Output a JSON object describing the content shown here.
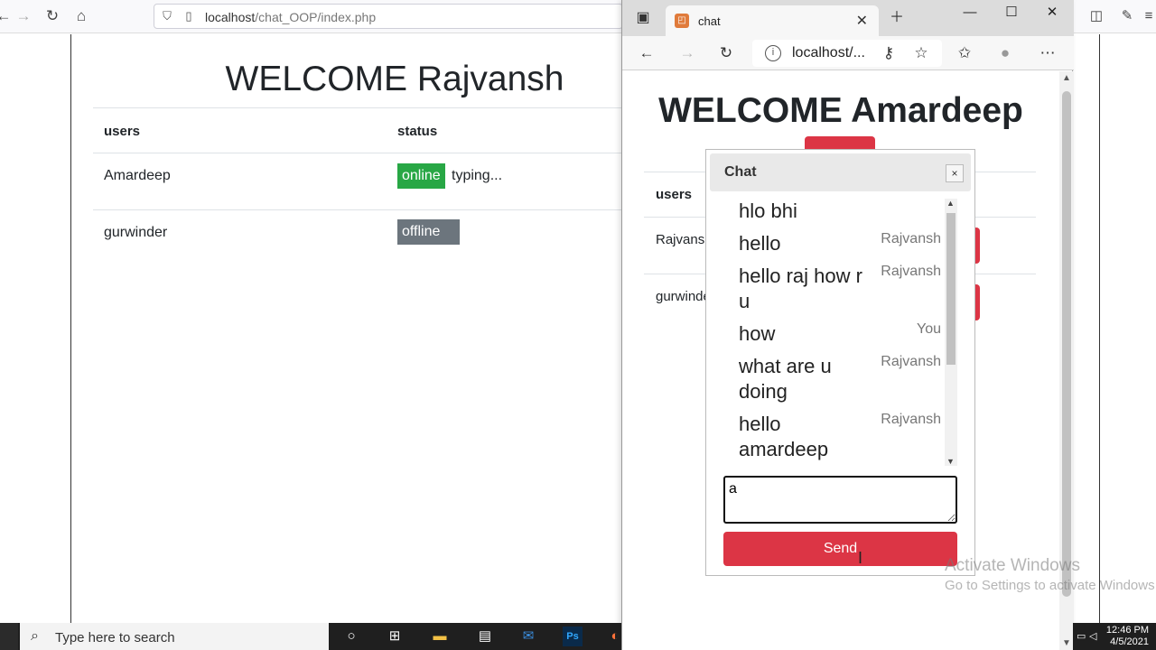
{
  "back_browser": {
    "url_host": "localhost",
    "url_path": "/chat_OOP/index.php",
    "page": {
      "title": "WELCOME Rajvansh",
      "table": {
        "headers": [
          "users",
          "status"
        ],
        "rows": [
          {
            "user": "Amardeep",
            "status": "online",
            "extra": "typing..."
          },
          {
            "user": "gurwinder",
            "status": "offline",
            "extra": ""
          }
        ]
      }
    }
  },
  "front_browser": {
    "tab_title": "chat",
    "address": "localhost/...",
    "page": {
      "title": "WELCOME Amardeep",
      "table": {
        "headers": [
          "users"
        ],
        "rows": [
          {
            "user": "Rajvansh"
          },
          {
            "user": "gurwinder"
          }
        ]
      },
      "chat": {
        "title": "Chat",
        "close_label": "×",
        "messages": [
          {
            "text": "hlo bhi",
            "from": ""
          },
          {
            "text": "hello",
            "from": "Rajvansh"
          },
          {
            "text": "hello raj how r u",
            "from": "Rajvansh"
          },
          {
            "text": "how",
            "from": "You"
          },
          {
            "text": "what are u doing",
            "from": "Rajvansh"
          },
          {
            "text": "hello amardeep",
            "from": "Rajvansh"
          }
        ],
        "input_value": "a",
        "send_label": "Send"
      }
    }
  },
  "taskbar": {
    "search_placeholder": "Type here to search",
    "time": "12:46 PM",
    "date": "4/5/2021"
  },
  "watermark": {
    "line1": "Activate Windows",
    "line2": "Go to Settings to activate Windows"
  },
  "colors": {
    "online": "#28a745",
    "offline": "#6c757d",
    "danger": "#dc3545"
  }
}
